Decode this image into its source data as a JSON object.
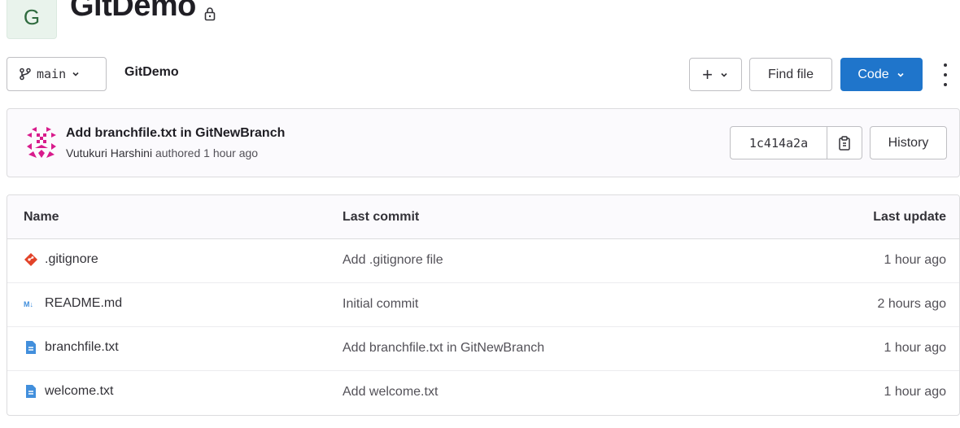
{
  "project": {
    "avatar_letter": "G",
    "name": "GitDemo",
    "visibility_icon": "lock-icon"
  },
  "toolbar": {
    "branch": "main",
    "breadcrumb": "GitDemo",
    "add_label": "+",
    "find_file_label": "Find file",
    "code_label": "Code"
  },
  "last_commit": {
    "title": "Add branchfile.txt in GitNewBranch",
    "author": "Vutukuri Harshini",
    "authored_text": "authored 1 hour ago",
    "sha": "1c414a2a",
    "history_label": "History"
  },
  "file_table": {
    "headers": {
      "name": "Name",
      "last_commit": "Last commit",
      "last_update": "Last update"
    },
    "rows": [
      {
        "name": ".gitignore",
        "icon": "git-icon",
        "commit": "Add .gitignore file",
        "updated": "1 hour ago"
      },
      {
        "name": "README.md",
        "icon": "markdown-icon",
        "commit": "Initial commit",
        "updated": "2 hours ago"
      },
      {
        "name": "branchfile.txt",
        "icon": "document-icon",
        "commit": "Add branchfile.txt in GitNewBranch",
        "updated": "1 hour ago"
      },
      {
        "name": "welcome.txt",
        "icon": "document-icon",
        "commit": "Add welcome.txt",
        "updated": "1 hour ago"
      }
    ]
  },
  "colors": {
    "primary": "#1f75cb",
    "git_orange": "#e24329",
    "file_blue": "#428fdc",
    "avatar_magenta": "#d81b8c"
  }
}
